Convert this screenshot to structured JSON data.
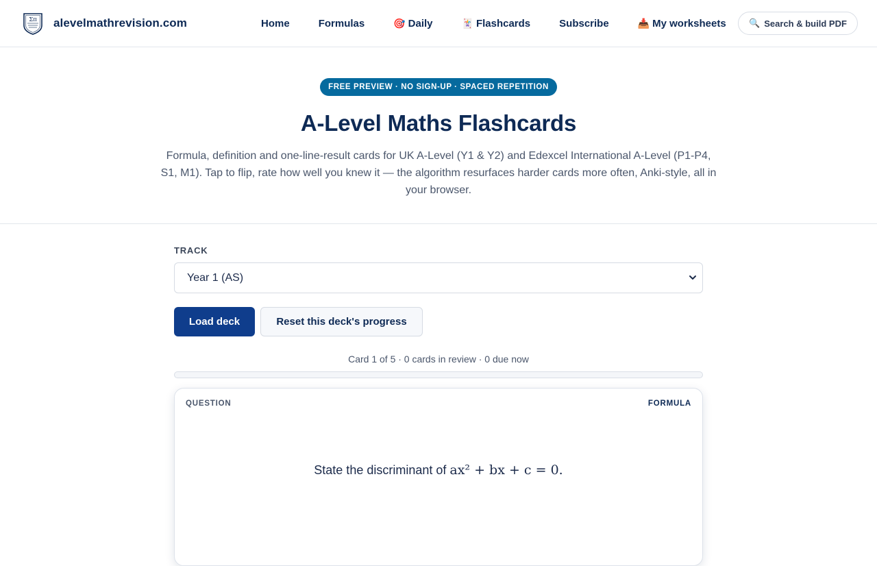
{
  "header": {
    "brand": {
      "name": "alevelmathrevision.com",
      "logo_icon": "sigma-pi-shield-icon"
    },
    "nav": [
      {
        "label": "Home",
        "emoji": ""
      },
      {
        "label": "Formulas",
        "emoji": ""
      },
      {
        "label": "Daily",
        "emoji": "🎯"
      },
      {
        "label": "Flashcards",
        "emoji": "🃏"
      },
      {
        "label": "Subscribe",
        "emoji": ""
      },
      {
        "label": "My worksheets",
        "emoji": "📥"
      }
    ],
    "search": {
      "label": "Search & build PDF",
      "emoji": "🔍"
    }
  },
  "hero": {
    "badge": "FREE PREVIEW · NO SIGN-UP · SPACED REPETITION",
    "title": "A-Level Maths Flashcards",
    "description": "Formula, definition and one-line-result cards for UK A-Level (Y1 & Y2) and Edexcel International A-Level (P1-P4, S1, M1). Tap to flip, rate how well you knew it — the algorithm resurfaces harder cards more often, Anki-style, all in your browser."
  },
  "controls": {
    "track_label": "TRACK",
    "track_selected": "Year 1 (AS)",
    "load_button": "Load deck",
    "reset_button": "Reset this deck's progress",
    "status": "Card 1 of 5 · 0 cards in review · 0 due now",
    "progress_fraction": 0
  },
  "card": {
    "side_label": "QUESTION",
    "type_label": "FORMULA",
    "question_text": "State the discriminant of ",
    "question_math": "ax² + bx + c = 0."
  },
  "colors": {
    "brand_navy": "#0e2a55",
    "badge_blue": "#066a9e",
    "primary_button": "#0f3d8c"
  }
}
